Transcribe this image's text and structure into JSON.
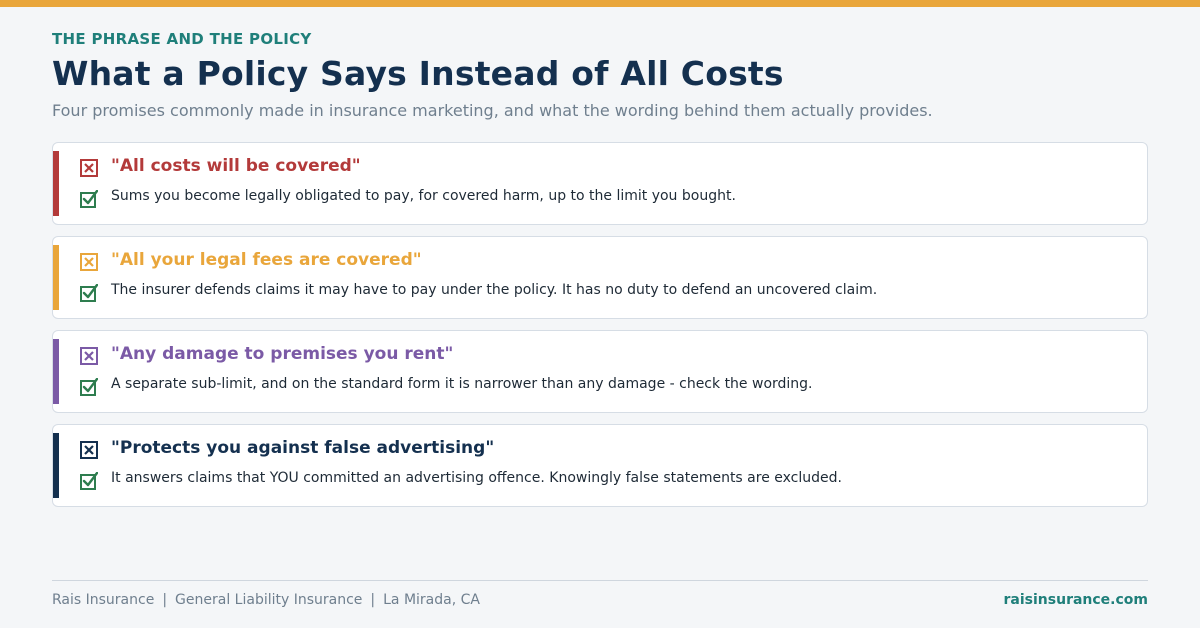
{
  "header": {
    "eyebrow": "THE PHRASE AND THE POLICY",
    "title": "What a Policy Says Instead of All Costs",
    "subtitle": "Four promises commonly made in insurance marketing, and what the wording behind them actually provides."
  },
  "colors": {
    "top_bar": "#e9a63b",
    "teal": "#1f7f7a",
    "navy": "#14304f",
    "check": "#2e7d4f"
  },
  "cards": [
    {
      "claim": "\"All costs will be covered\"",
      "reality": "Sums you become legally obligated to pay, for covered harm, up to the limit you bought.",
      "color": "#b33a3a",
      "claim_icon": "x-box-icon",
      "reality_icon": "check-box-icon"
    },
    {
      "claim": "\"All your legal fees are covered\"",
      "reality": "The insurer defends claims it may have to pay under the policy. It has no duty to defend an uncovered claim.",
      "color": "#e9a63b",
      "claim_icon": "x-box-icon",
      "reality_icon": "check-box-icon"
    },
    {
      "claim": "\"Any damage to premises you rent\"",
      "reality": "A separate sub-limit, and on the standard form it is narrower than any damage - check the wording.",
      "color": "#7b5aa6",
      "claim_icon": "x-box-icon",
      "reality_icon": "check-box-icon"
    },
    {
      "claim": "\"Protects you against false advertising\"",
      "reality": "It answers claims that YOU committed an advertising offence. Knowingly false statements are excluded.",
      "color": "#14304f",
      "claim_icon": "x-box-icon",
      "reality_icon": "check-box-icon"
    }
  ],
  "footer": {
    "company": "Rais Insurance",
    "product": "General Liability Insurance",
    "location": "La Mirada, CA",
    "separator": "|",
    "website": "raisinsurance.com"
  }
}
